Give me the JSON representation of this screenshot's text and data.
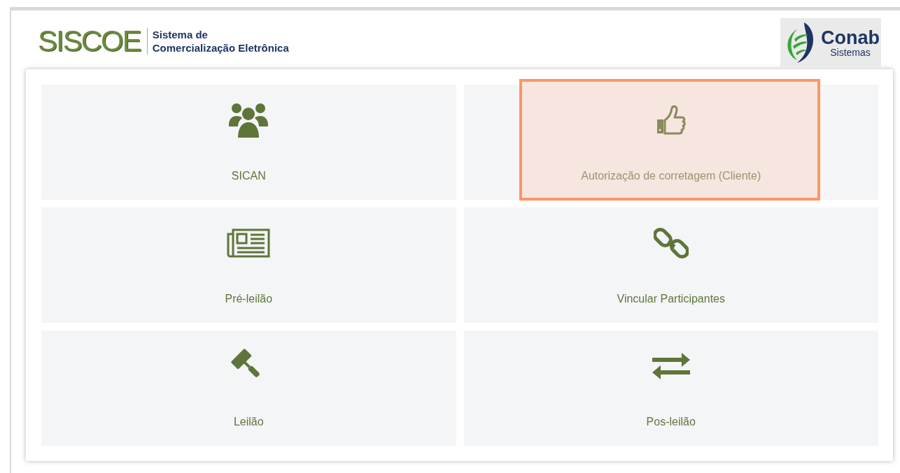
{
  "header": {
    "logo": "SISCOE",
    "subtitle_line_1": "Sistema de",
    "subtitle_line_2": "Comercialização Eletrônica",
    "partner_logo": {
      "name": "Conab",
      "tagline": "Sistemas"
    }
  },
  "tiles": [
    {
      "label": "SICAN",
      "kind": "users",
      "highlighted": false
    },
    {
      "label": "Autorização de corretagem (Cliente)",
      "kind": "thumbs",
      "highlighted": true
    },
    {
      "label": "Pré-leilão",
      "kind": "news",
      "highlighted": false
    },
    {
      "label": "Vincular Participantes",
      "kind": "link",
      "highlighted": false
    },
    {
      "label": "Leilão",
      "kind": "gavel",
      "highlighted": false
    },
    {
      "label": "Pos-leilão",
      "kind": "exchange",
      "highlighted": false
    }
  ]
}
